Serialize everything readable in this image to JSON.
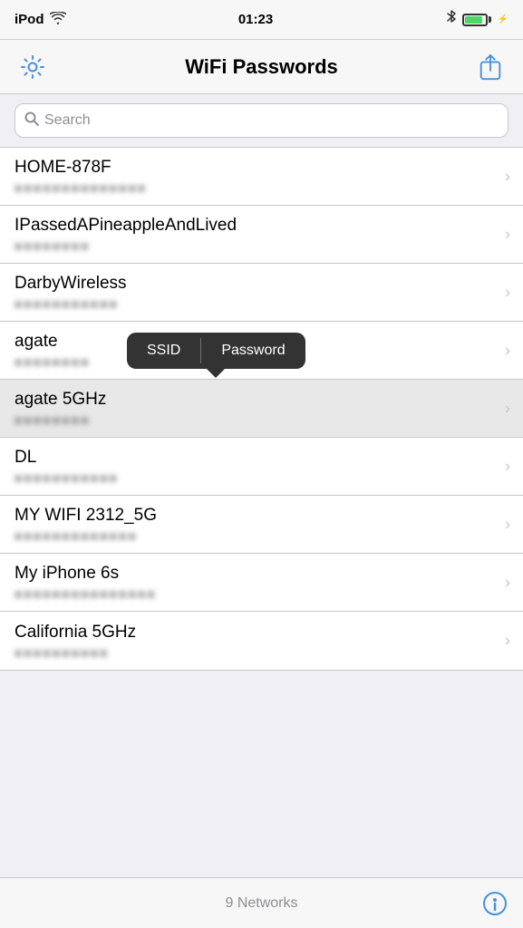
{
  "status": {
    "carrier": "iPod",
    "time": "01:23",
    "battery_level": 80
  },
  "header": {
    "title": "WiFi Passwords",
    "settings_label": "Settings",
    "share_label": "Share"
  },
  "search": {
    "placeholder": "Search"
  },
  "tooltip": {
    "ssid_label": "SSID",
    "password_label": "Password"
  },
  "networks": [
    {
      "id": 1,
      "name": "HOME-878F",
      "password": "••••••••••••••",
      "highlighted": false
    },
    {
      "id": 2,
      "name": "IPassedAPineappleAndLived",
      "password": "••••••••",
      "highlighted": false
    },
    {
      "id": 3,
      "name": "DarbyWireless",
      "password": "•••••••••••",
      "highlighted": false
    },
    {
      "id": 4,
      "name": "agate",
      "password": "••••••••",
      "highlighted": false,
      "tooltip": true
    },
    {
      "id": 5,
      "name": "agate 5GHz",
      "password": "••••••••",
      "highlighted": true
    },
    {
      "id": 6,
      "name": "DL",
      "password": "•••••••••••",
      "highlighted": false
    },
    {
      "id": 7,
      "name": "MY WIFI 2312_5G",
      "password": "•••••••••••••",
      "highlighted": false
    },
    {
      "id": 8,
      "name": "My iPhone 6s",
      "password": "•••••••••••••••",
      "highlighted": false
    },
    {
      "id": 9,
      "name": "California 5GHz",
      "password": "••••••••••",
      "highlighted": false
    }
  ],
  "footer": {
    "network_count": "9 Networks"
  }
}
